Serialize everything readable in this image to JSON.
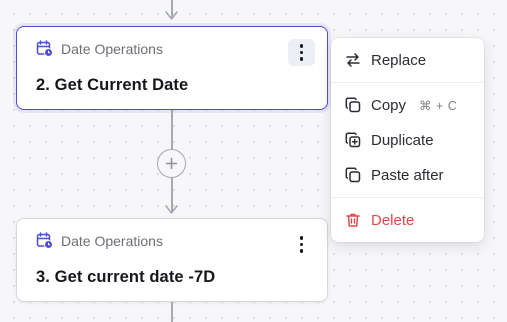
{
  "nodes": [
    {
      "category": "Date Operations",
      "title": "2. Get Current Date",
      "selected": true,
      "icon": "calendar-clock-icon"
    },
    {
      "category": "Date Operations",
      "title": "3. Get current date -7D",
      "selected": false,
      "icon": "calendar-clock-icon"
    }
  ],
  "context_menu": {
    "replace": "Replace",
    "copy": "Copy",
    "copy_shortcut": "⌘ + C",
    "duplicate": "Duplicate",
    "paste_after": "Paste after",
    "delete": "Delete"
  },
  "colors": {
    "accent": "#4b4fd6",
    "danger": "#e24848",
    "connector": "#a6a9b4"
  }
}
